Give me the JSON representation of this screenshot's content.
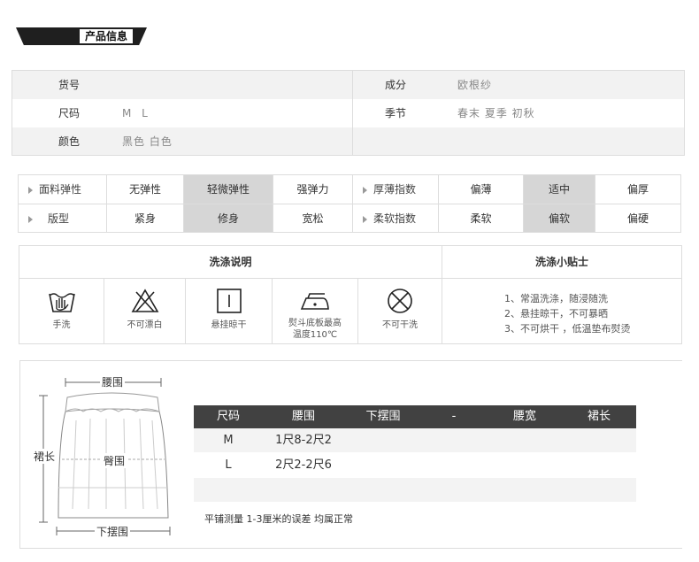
{
  "title": "产品信息",
  "info": {
    "item_no_label": "货号",
    "item_no_value": "",
    "size_label": "尺码",
    "size_value": "M L",
    "color_label": "颜色",
    "color_value": "黑色 白色",
    "composition_label": "成分",
    "composition_value": "欧根纱",
    "season_label": "季节",
    "season_value": "春末 夏季 初秋"
  },
  "attributes": {
    "rows": [
      {
        "left_label": "面料弹性",
        "left_options": [
          "无弹性",
          "轻微弹性",
          "强弹力"
        ],
        "left_selected": 1,
        "right_label": "厚薄指数",
        "right_options": [
          "偏薄",
          "适中",
          "偏厚"
        ],
        "right_selected": 1
      },
      {
        "left_label": "版型",
        "left_options": [
          "紧身",
          "修身",
          "宽松"
        ],
        "left_selected": 1,
        "right_label": "柔软指数",
        "right_options": [
          "柔软",
          "偏软",
          "偏硬"
        ],
        "right_selected": 1
      }
    ],
    "highlight_color": "#d6d6d6"
  },
  "wash": {
    "instructions_title": "洗涤说明",
    "tips_title": "洗涤小贴士",
    "icons": [
      {
        "icon": "hand-wash-icon",
        "caption_line1": "手洗",
        "caption_line2": ""
      },
      {
        "icon": "no-bleach-icon",
        "caption_line1": "不可漂白",
        "caption_line2": ""
      },
      {
        "icon": "hang-dry-icon",
        "caption_line1": "悬挂晾干",
        "caption_line2": ""
      },
      {
        "icon": "iron-icon",
        "caption_line1": "熨斗底板最高",
        "caption_line2": "温度110℃"
      },
      {
        "icon": "no-dry-clean-icon",
        "caption_line1": "不可干洗",
        "caption_line2": ""
      }
    ],
    "tips": [
      "1、常温洗涤，随浸随洗",
      "2、悬挂晾干，不可暴晒",
      "3、不可烘干 ，低温垫布熨烫"
    ]
  },
  "diagram": {
    "waist_label": "腰围",
    "length_label": "裙长",
    "hip_label": "臀围",
    "hem_label": "下摆围"
  },
  "size_table": {
    "headers": [
      "尺码",
      "腰围",
      "下摆围",
      "-",
      "腰宽",
      "裙长"
    ],
    "rows": [
      [
        "M",
        "1尺8-2尺2",
        "",
        "",
        "",
        ""
      ],
      [
        "L",
        "2尺2-2尺6",
        "",
        "",
        "",
        ""
      ],
      [
        "",
        "",
        "",
        "",
        "",
        ""
      ]
    ],
    "header_color": "#414141",
    "note": "平铺测量 1-3厘米的误差 均属正常"
  }
}
